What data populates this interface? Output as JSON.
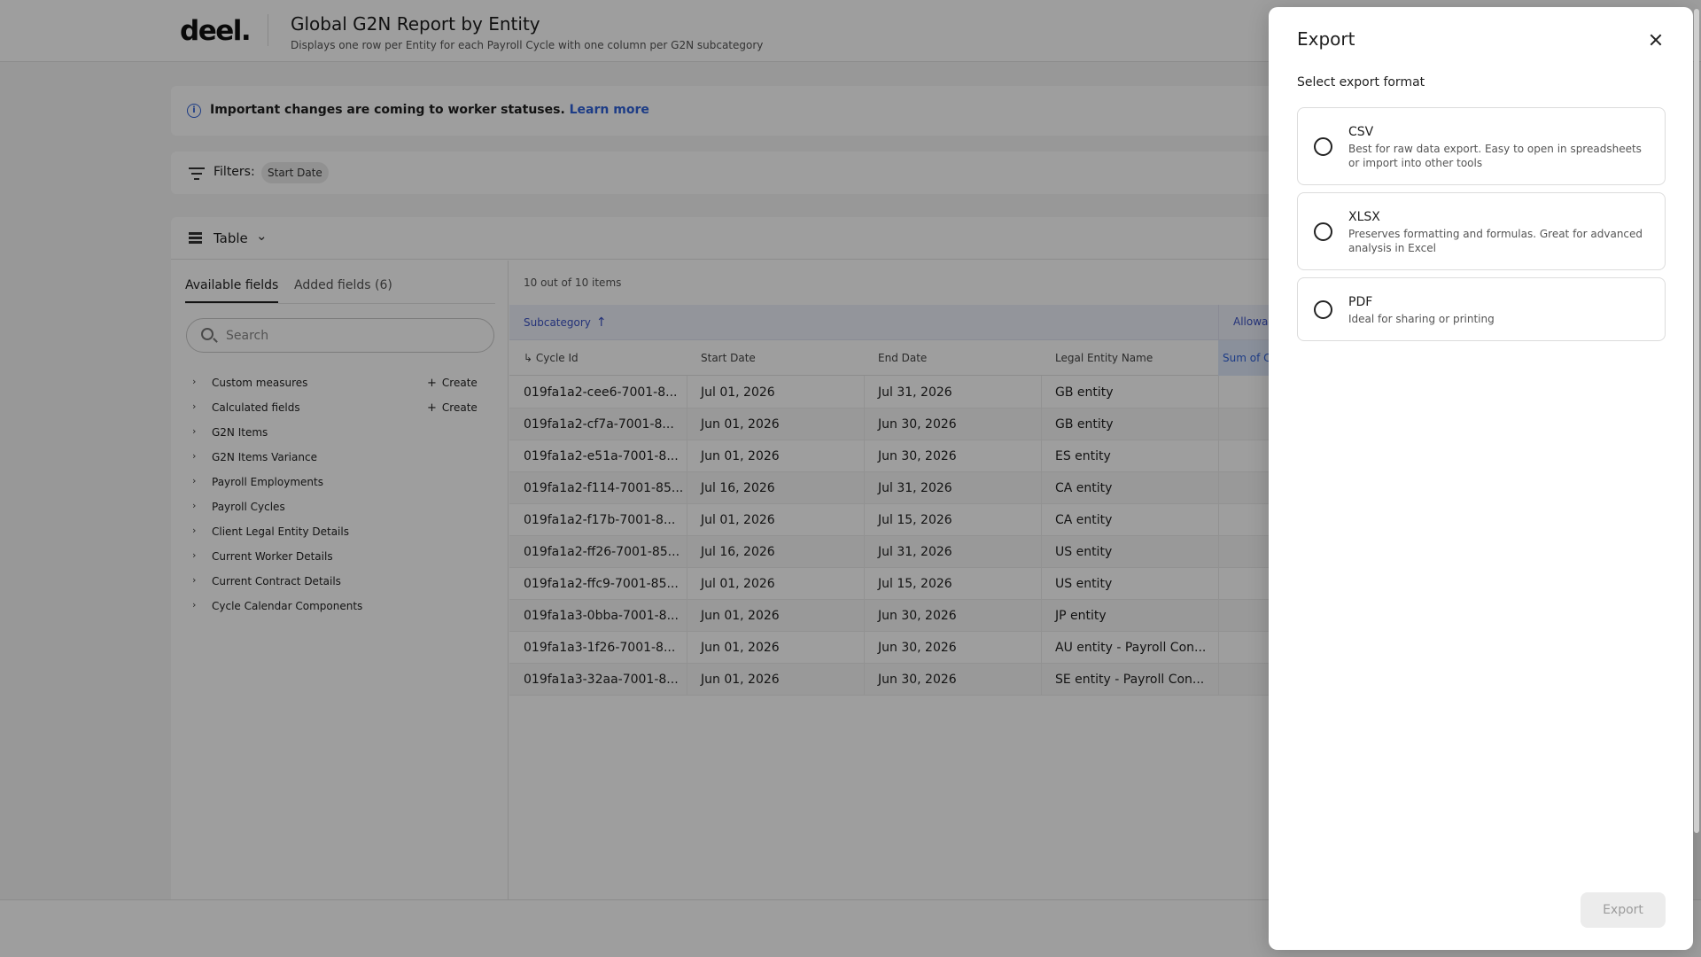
{
  "header": {
    "logo": "deel.",
    "title": "Global G2N Report by Entity",
    "subtitle": "Displays one row per Entity for each Payroll Cycle with one column per G2N subcategory"
  },
  "notice": {
    "icon": "info-icon",
    "text": "Important changes are coming to worker statuses.",
    "link": "Learn more"
  },
  "filters": {
    "label": "Filters:",
    "chip": "Start Date"
  },
  "view": {
    "label": "Table"
  },
  "sidebar": {
    "tabs": [
      {
        "label": "Available fields",
        "active": true
      },
      {
        "label": "Added fields (6)",
        "active": false
      }
    ],
    "search_placeholder": "Search",
    "create_label": "Create",
    "items": [
      {
        "label": "Custom measures",
        "create": true
      },
      {
        "label": "Calculated fields",
        "create": true
      },
      {
        "label": "G2N Items",
        "create": false
      },
      {
        "label": "G2N Items Variance",
        "create": false
      },
      {
        "label": "Payroll Employments",
        "create": false
      },
      {
        "label": "Payroll Cycles",
        "create": false
      },
      {
        "label": "Client Legal Entity Details",
        "create": false
      },
      {
        "label": "Current Worker Details",
        "create": false
      },
      {
        "label": "Current Contract Details",
        "create": false
      },
      {
        "label": "Cycle Calendar Components",
        "create": false
      }
    ]
  },
  "table": {
    "count": "10 out of 10 items",
    "group_label": "Subcategory",
    "group_right": "Allowa",
    "sum_header": "Sum of C",
    "columns": [
      "↳ Cycle Id",
      "Start Date",
      "End Date",
      "Legal Entity Name"
    ],
    "rows": [
      [
        "019fa1a2-cee6-7001-8...",
        "Jul 01, 2026",
        "Jul 31, 2026",
        "GB entity"
      ],
      [
        "019fa1a2-cf7a-7001-8...",
        "Jun 01, 2026",
        "Jun 30, 2026",
        "GB entity"
      ],
      [
        "019fa1a2-e51a-7001-8...",
        "Jun 01, 2026",
        "Jun 30, 2026",
        "ES entity"
      ],
      [
        "019fa1a2-f114-7001-85...",
        "Jul 16, 2026",
        "Jul 31, 2026",
        "CA entity"
      ],
      [
        "019fa1a2-f17b-7001-8...",
        "Jul 01, 2026",
        "Jul 15, 2026",
        "CA entity"
      ],
      [
        "019fa1a2-ff26-7001-85...",
        "Jul 16, 2026",
        "Jul 31, 2026",
        "US entity"
      ],
      [
        "019fa1a2-ffc9-7001-85...",
        "Jul 01, 2026",
        "Jul 15, 2026",
        "US entity"
      ],
      [
        "019fa1a3-0bba-7001-8...",
        "Jun 01, 2026",
        "Jun 30, 2026",
        "JP entity"
      ],
      [
        "019fa1a3-1f26-7001-8...",
        "Jun 01, 2026",
        "Jun 30, 2026",
        "AU entity - Payroll Con..."
      ],
      [
        "019fa1a3-32aa-7001-8...",
        "Jun 01, 2026",
        "Jun 30, 2026",
        "SE entity - Payroll Con..."
      ]
    ]
  },
  "drawer": {
    "title": "Export",
    "section_label": "Select export format",
    "options": [
      {
        "title": "CSV",
        "desc": "Best for raw data export. Easy to open in spreadsheets or import into other tools"
      },
      {
        "title": "XLSX",
        "desc": "Preserves formatting and formulas. Great for advanced analysis in Excel"
      },
      {
        "title": "PDF",
        "desc": "Ideal for sharing or printing"
      }
    ],
    "export_label": "Export"
  },
  "colors": {
    "accent": "#2f62d8",
    "group_text": "#3a52c4",
    "overlay": "rgba(0,0,0,0.38)"
  }
}
